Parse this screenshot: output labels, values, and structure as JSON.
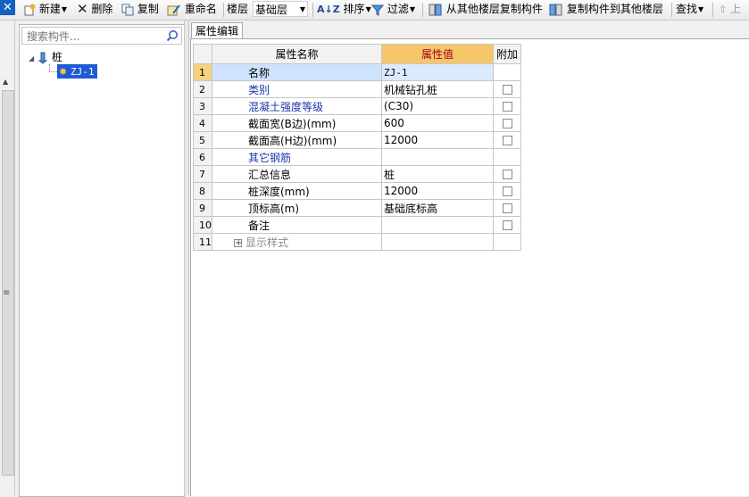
{
  "toolbar": {
    "close_glyph": "✕",
    "new_label": "新建",
    "delete_label": "删除",
    "copy_label": "复制",
    "rename_label": "重命名",
    "floor_label": "楼层",
    "floor_value": "基础层",
    "sort_label": "排序",
    "filter_label": "过滤",
    "copy_from_floor_label": "从其他楼层复制构件",
    "copy_to_floor_label": "复制构件到其他楼层",
    "find_label": "查找",
    "up_label": "上"
  },
  "search": {
    "placeholder": "搜索构件..."
  },
  "tree": {
    "root_label": "桩",
    "child_label": "ZJ-1"
  },
  "tab": {
    "label": "属性编辑"
  },
  "table": {
    "headers": [
      "属性名称",
      "属性值",
      "附加"
    ],
    "rows": [
      {
        "num": "1",
        "name": "名称",
        "value": "ZJ-1"
      },
      {
        "num": "2",
        "name": "类别",
        "value": "机械钻孔桩"
      },
      {
        "num": "3",
        "name": "混凝土强度等级",
        "value": "(C30)"
      },
      {
        "num": "4",
        "name": "截面宽(B边)(mm)",
        "value": "600"
      },
      {
        "num": "5",
        "name": "截面高(H边)(mm)",
        "value": "12000"
      },
      {
        "num": "6",
        "name": "其它钢筋",
        "value": ""
      },
      {
        "num": "7",
        "name": "汇总信息",
        "value": "桩"
      },
      {
        "num": "8",
        "name": "桩深度(mm)",
        "value": "12000"
      },
      {
        "num": "9",
        "name": "顶标高(m)",
        "value": "基础底标高"
      },
      {
        "num": "10",
        "name": "备注",
        "value": ""
      },
      {
        "num": "11",
        "name": "显示样式",
        "value": ""
      }
    ]
  }
}
